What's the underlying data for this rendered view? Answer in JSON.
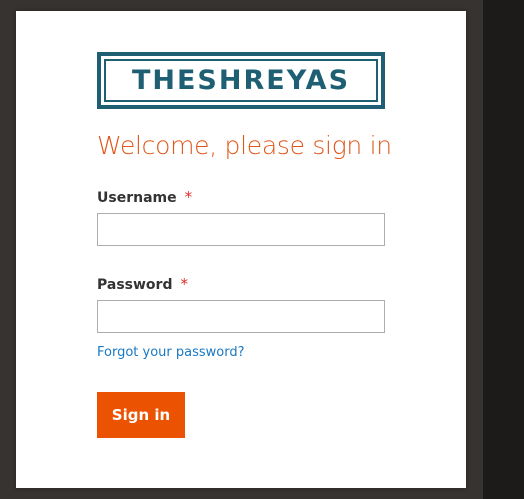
{
  "logo": {
    "text": "THESHREYAS"
  },
  "login": {
    "heading": "Welcome, please sign in",
    "username_label": "Username",
    "password_label": "Password",
    "required_marker": "*",
    "username_value": "",
    "password_value": "",
    "forgot_link": "Forgot your password?",
    "signin_label": "Sign in"
  },
  "colors": {
    "brand": "#1e5f73",
    "heading": "#e0571b",
    "button": "#eb5202",
    "link": "#1979c3",
    "required": "#e02b27"
  }
}
